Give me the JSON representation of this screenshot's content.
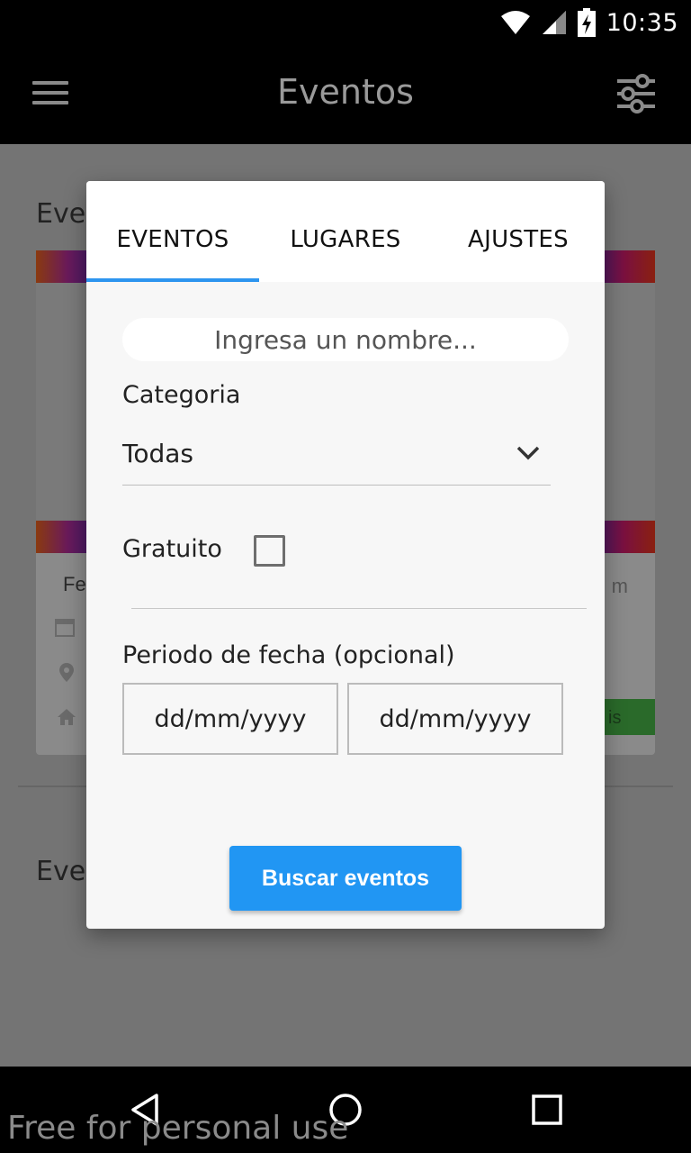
{
  "status_bar": {
    "time": "10:35"
  },
  "app_bar": {
    "title": "Eventos"
  },
  "background": {
    "section1_heading": "Eve",
    "section2_heading": "Eve",
    "card_title": "Fe",
    "card_right_text": "m",
    "card_button_text": "is"
  },
  "dialog": {
    "tabs": [
      {
        "label": "EVENTOS",
        "selected": true
      },
      {
        "label": "LUGARES",
        "selected": false
      },
      {
        "label": "AJUSTES",
        "selected": false
      }
    ],
    "name_placeholder": "Ingresa un nombre...",
    "category_label": "Categoria",
    "category_value": "Todas",
    "free_label": "Gratuito",
    "free_checked": false,
    "date_range_label": "Periodo de fecha (opcional)",
    "date_from_placeholder": "dd/mm/yyyy",
    "date_to_placeholder": "dd/mm/yyyy",
    "search_button": "Buscar eventos"
  },
  "watermark": "Free for personal use",
  "colors": {
    "accent": "#2196f3",
    "tab_indicator": "#2d95ef"
  }
}
